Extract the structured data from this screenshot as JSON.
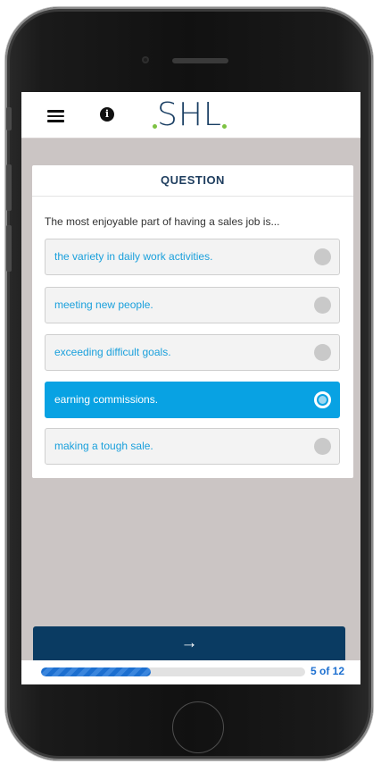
{
  "header": {
    "logo_text": "SHL",
    "logo_dot_color": "#7dc242",
    "menu_icon": "hamburger-icon",
    "info_icon": "info-icon",
    "info_glyph": "i"
  },
  "card": {
    "title": "QUESTION",
    "question": "The most enjoyable part of having a sales job is...",
    "options": [
      {
        "label": "the variety in daily work activities.",
        "selected": false
      },
      {
        "label": "meeting new people.",
        "selected": false
      },
      {
        "label": "exceeding difficult goals.",
        "selected": false
      },
      {
        "label": "earning commissions.",
        "selected": true
      },
      {
        "label": "making a tough sale.",
        "selected": false
      }
    ]
  },
  "footer": {
    "next_glyph": "→",
    "progress_text": "5 of 12",
    "progress_fraction": 0.4167
  },
  "colors": {
    "accent": "#08a2e3",
    "brand": "#0a3b62",
    "progress": "#1c6fd0"
  }
}
